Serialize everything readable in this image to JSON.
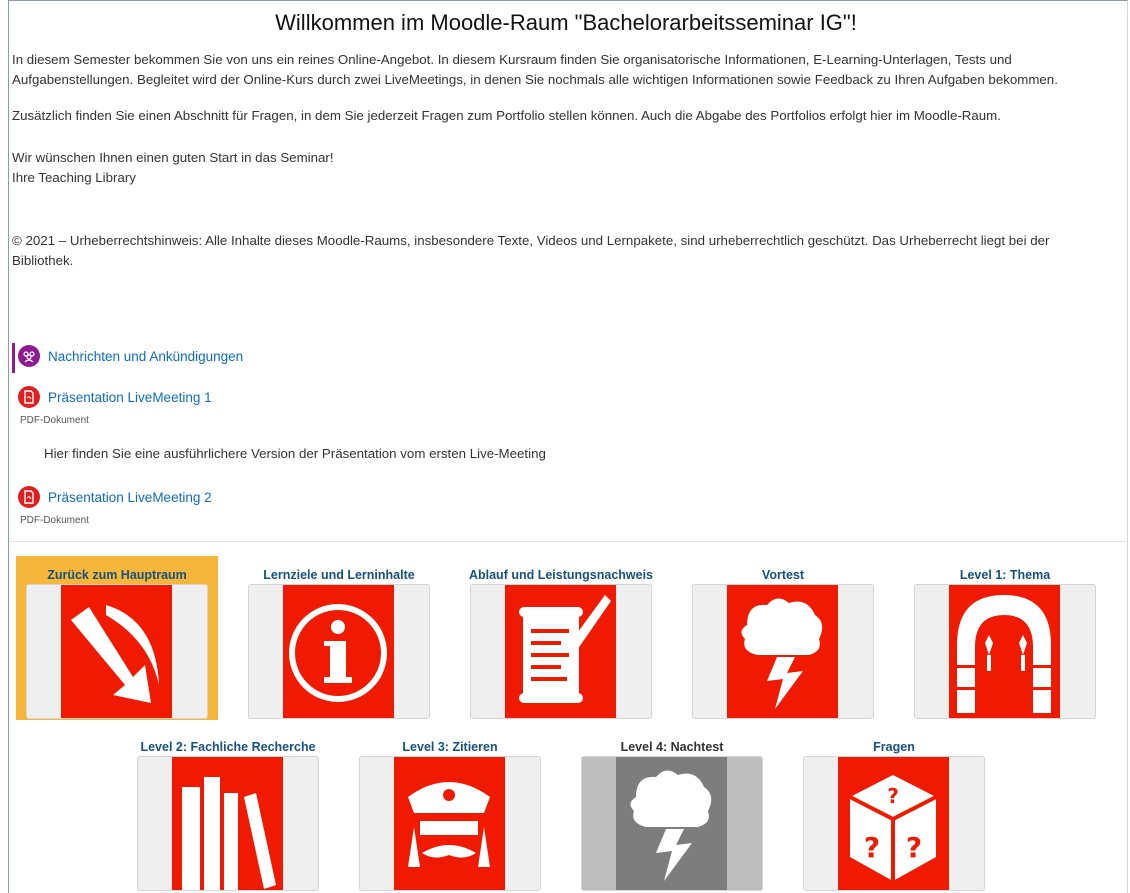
{
  "title": "Willkommen im Moodle-Raum \"Bachelorarbeitsseminar IG\"!",
  "intro": {
    "p1": "In diesem Semester bekommen Sie von uns ein reines Online-Angebot. In diesem Kursraum finden Sie organisatorische Informationen, E-Learning-Unterlagen, Tests und Aufgabenstellungen. Begleitet wird der Online-Kurs durch zwei LiveMeetings, in denen Sie nochmals alle wichtigen Informationen sowie Feedback zu Ihren Aufgaben bekommen.",
    "p2": "Zusätzlich finden Sie einen Abschnitt für Fragen, in dem Sie jederzeit Fragen zum Portfolio stellen können. Auch die Abgabe des Portfolios erfolgt hier im Moodle-Raum.",
    "p3a": "Wir wünschen Ihnen einen guten Start in das Seminar!",
    "p3b": "Ihre Teaching Library",
    "copyright": "© 2021 – Urheberrechtshinweis: Alle Inhalte dieses Moodle-Raums, insbesondere Texte, Videos und Lernpakete, sind urheberrechtlich geschützt. Das Urheberrecht liegt bei der Bibliothek."
  },
  "activities": {
    "forum": {
      "label": "Nachrichten und Ankündigungen",
      "icon": "forum-icon",
      "color": "#8b1b8f"
    },
    "pdf1": {
      "label": "Präsentation LiveMeeting 1",
      "type": "PDF-Dokument",
      "icon": "pdf-icon",
      "color": "#e02020",
      "description": "Hier finden Sie eine ausführlichere Version der Präsentation vom ersten Live-Meeting"
    },
    "pdf2": {
      "label": "Präsentation LiveMeeting 2",
      "type": "PDF-Dokument",
      "icon": "pdf-icon",
      "color": "#e02020"
    }
  },
  "tiles": [
    {
      "title": "Zurück zum Hauptraum",
      "icon": "arrow-down-right-icon",
      "active": true
    },
    {
      "title": "Lernziele und Lerninhalte",
      "icon": "info-icon"
    },
    {
      "title": "Ablauf und Leistungsnachweis",
      "icon": "scroll-quill-icon"
    },
    {
      "title": "Vortest",
      "icon": "brain-lightning-icon"
    },
    {
      "title": "Level 1: Thema",
      "icon": "arch-torches-icon"
    },
    {
      "title": "Level 2: Fachliche Recherche",
      "icon": "books-icon"
    },
    {
      "title": "Level 3: Zitieren",
      "icon": "police-officer-icon"
    },
    {
      "title": "Level 4: Nachtest",
      "icon": "brain-lightning-icon",
      "disabled": true
    },
    {
      "title": "Fragen",
      "icon": "question-dice-icon"
    }
  ],
  "colors": {
    "accent": "#0f6cbf",
    "tile_red": "#f01a00",
    "active_tile": "#f6b63c"
  }
}
